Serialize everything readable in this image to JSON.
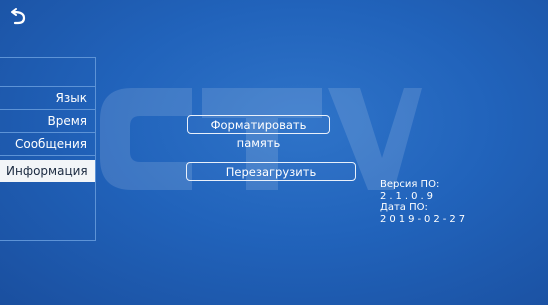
{
  "screen": {
    "background_color": "#1f5cb4",
    "accent_color": "#f2f5f8",
    "watermark_logo": "CTV"
  },
  "header": {
    "back_icon": "return-arrow-icon"
  },
  "sidebar": {
    "items": [
      {
        "label": "Язык",
        "active": false
      },
      {
        "label": "Время",
        "active": false
      },
      {
        "label": "Сообщения",
        "active": false
      },
      {
        "label": "Информация",
        "active": true
      }
    ]
  },
  "main": {
    "format_button_label": "Форматировать память",
    "restart_button_label": "Перезагрузить"
  },
  "info": {
    "version_label": "Версия ПО:",
    "version_value": "2.1.0.9",
    "date_label": "Дата ПО:",
    "date_value": "2019-02-27"
  }
}
